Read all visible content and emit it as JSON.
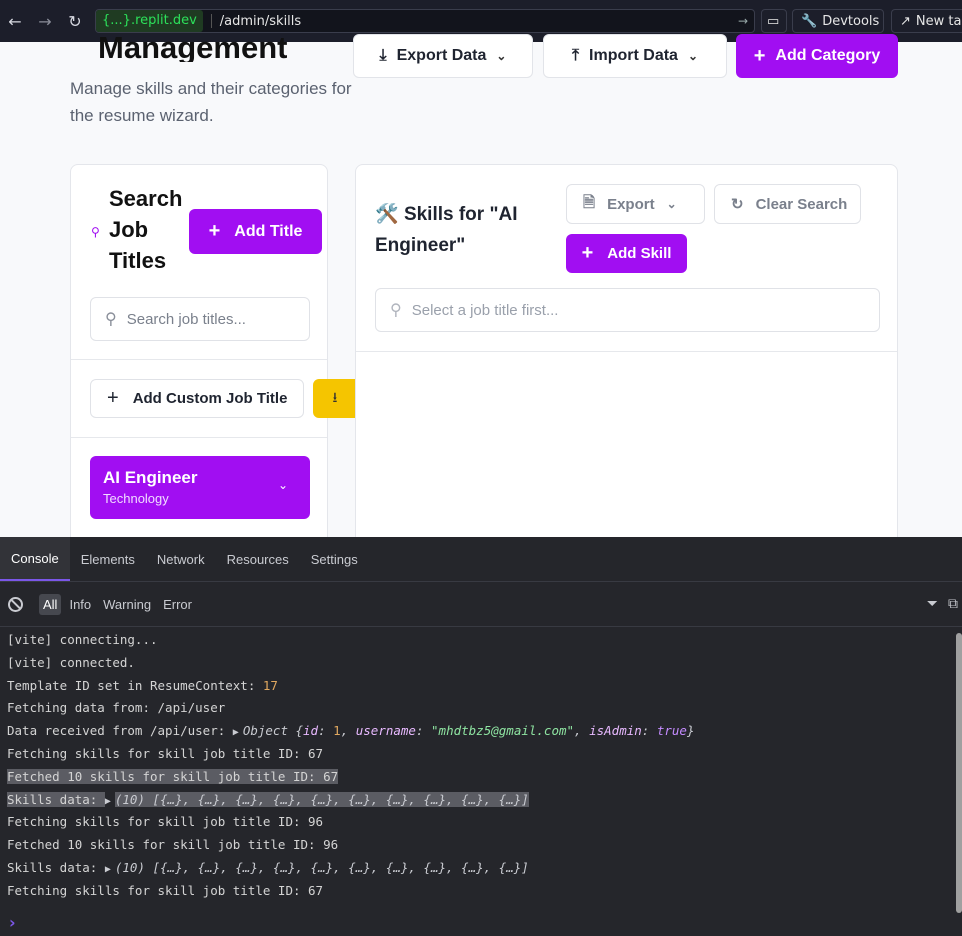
{
  "browser": {
    "url_host": "{...}.replit.dev",
    "url_path": "/admin/skills",
    "devtools_label": "Devtools",
    "newtab_label": "New tab"
  },
  "header": {
    "title": "Management",
    "subtitle": "Manage skills and their categories for the resume wizard.",
    "export_label": "Export Data",
    "import_label": "Import Data",
    "add_category_label": "Add Category"
  },
  "left_panel": {
    "title": "Search Job Titles",
    "add_title_label": "Add Title",
    "search_placeholder": "Search job titles...",
    "add_custom_label": "Add Custom Job Title",
    "job_items": [
      {
        "name": "AI Engineer",
        "category": "Technology"
      }
    ]
  },
  "right_panel": {
    "title": "Skills for \"AI Engineer\"",
    "export_label": "Export",
    "clear_search_label": "Clear Search",
    "add_skill_label": "Add Skill",
    "search_placeholder": "Select a job title first..."
  },
  "devtools": {
    "tabs": [
      "Console",
      "Elements",
      "Network",
      "Resources",
      "Settings"
    ],
    "active_tab": "Console",
    "filters": [
      "All",
      "Info",
      "Warning",
      "Error"
    ],
    "lines": {
      "l1": "[vite] connecting...",
      "l2": "[vite] connected.",
      "l3_text": "Template ID set in ResumeContext: ",
      "l3_num": "17",
      "l4": "Fetching data from: /api/user",
      "l5_text": "Data received from /api/user: ",
      "l5_obj": "Object {",
      "l5_k1": "id",
      "l5_v1": "1",
      "l5_k2": "username",
      "l5_v2": "\"mhdtbz5@gmail.com\"",
      "l5_k3": "isAdmin",
      "l5_v3": "true",
      "l6": "Fetching skills for skill job title ID: 67",
      "l7": "Fetched 10 skills for skill job title ID: 67",
      "l8_text": "Skills data: ",
      "l8_arr": "(10) [{…}, {…}, {…}, {…}, {…}, {…}, {…}, {…}, {…}, {…}]",
      "l9": "Fetching skills for skill job title ID: 96",
      "l10": "Fetched 10 skills for skill job title ID: 96",
      "l11_text": "Skills data: ",
      "l11_arr": "(10) [{…}, {…}, {…}, {…}, {…}, {…}, {…}, {…}, {…}, {…}]",
      "l12": "Fetching skills for skill job title ID: 67"
    }
  }
}
